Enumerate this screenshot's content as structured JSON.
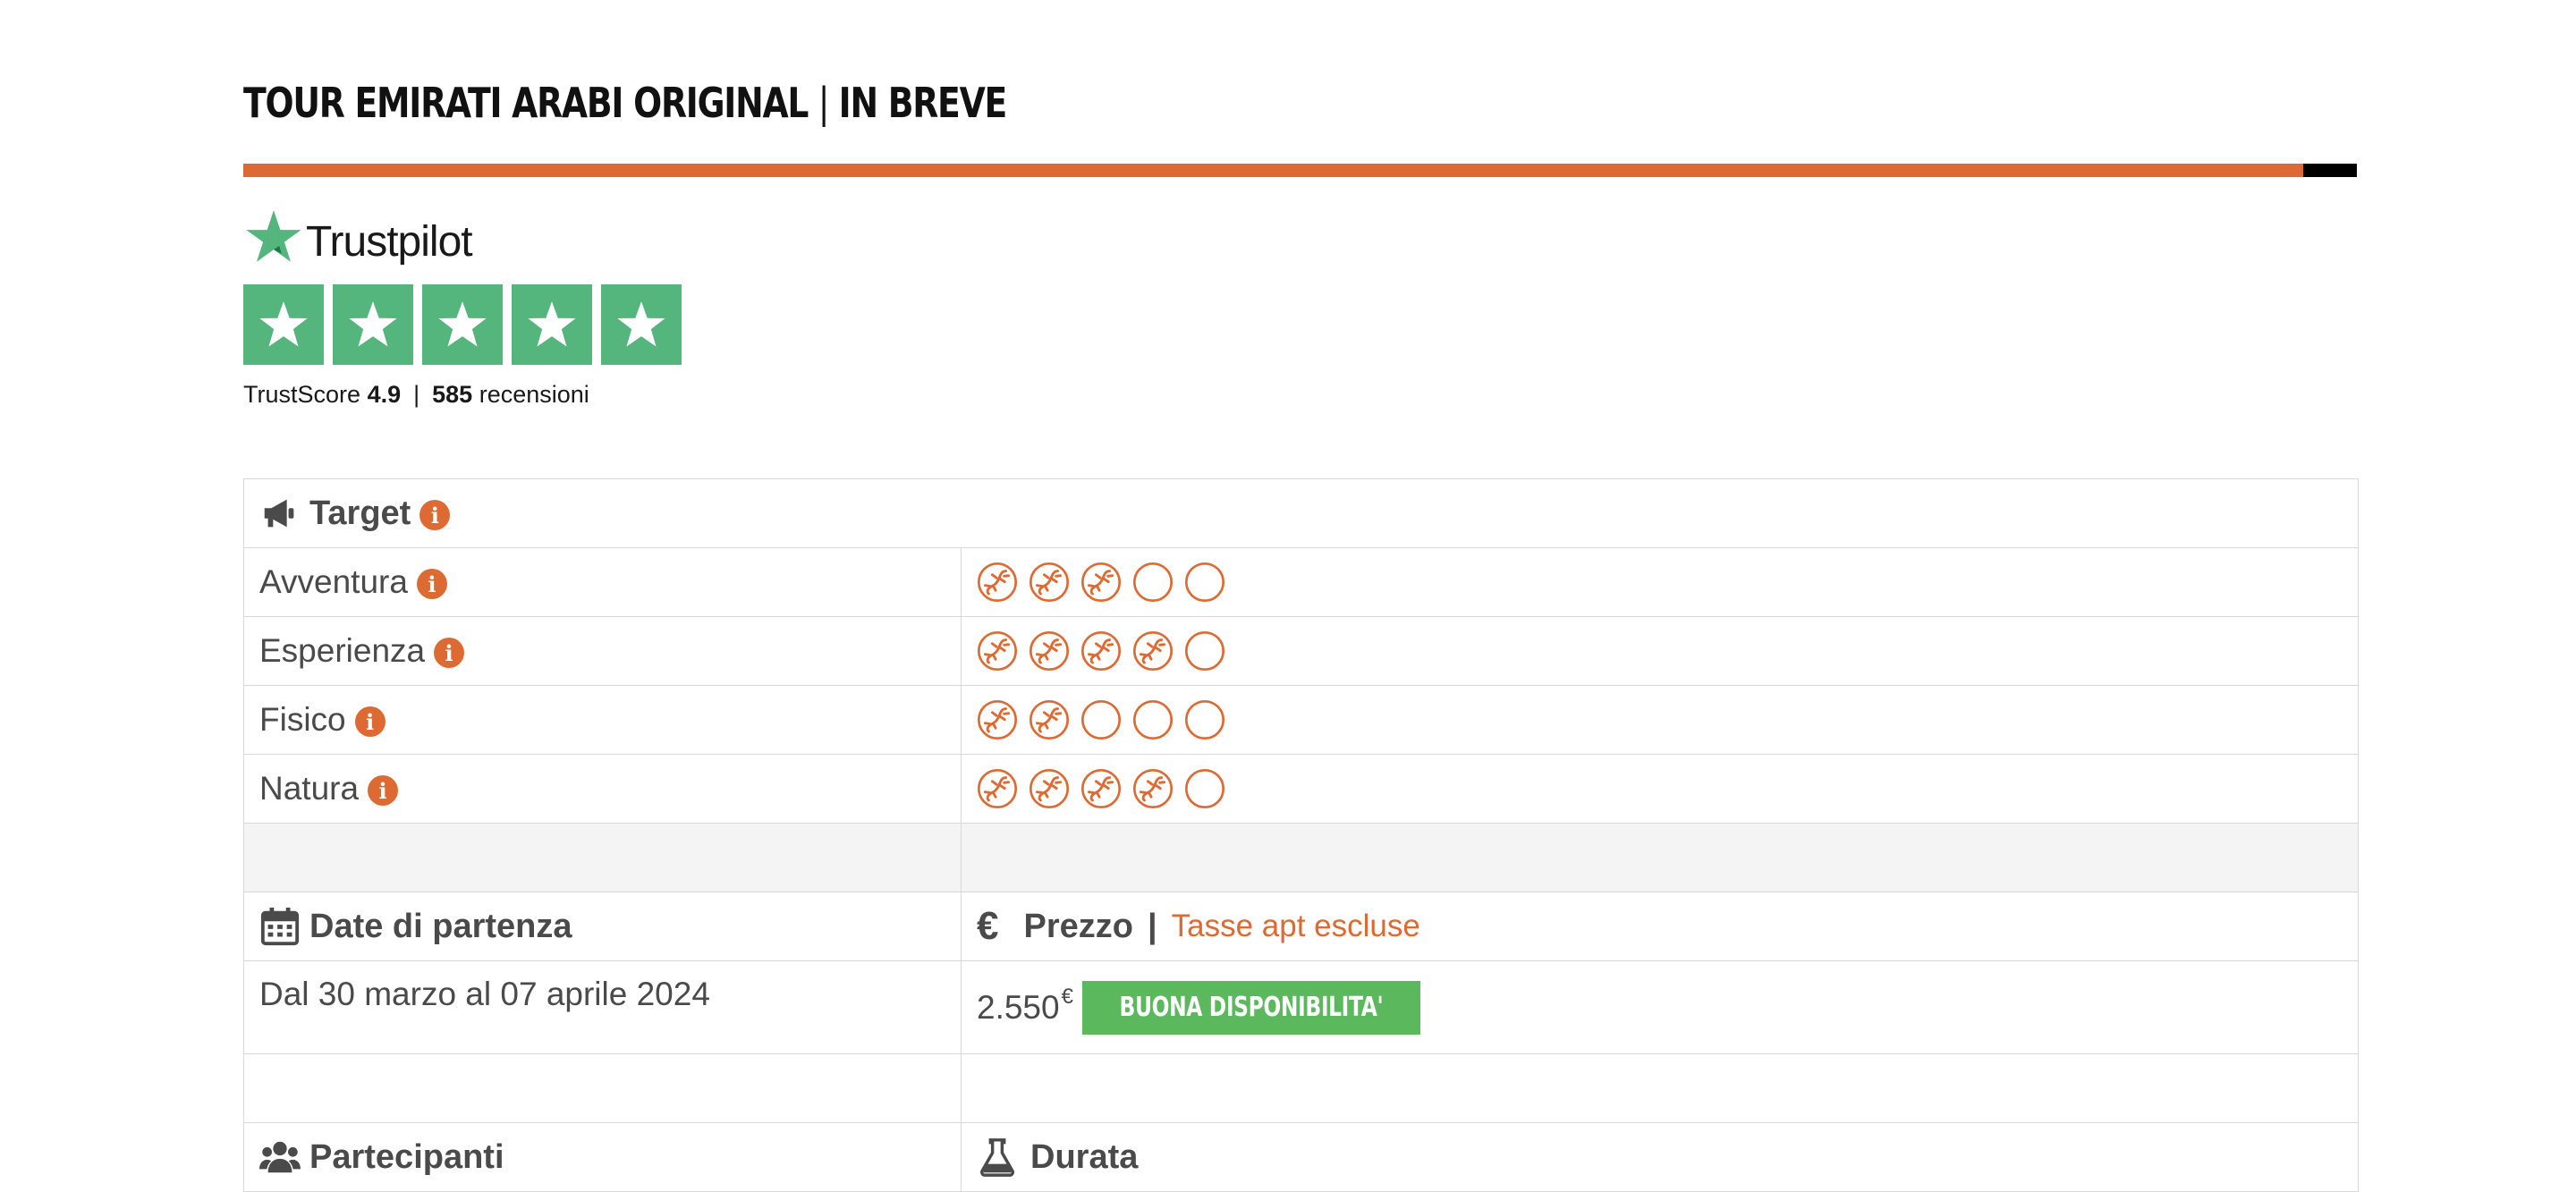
{
  "page": {
    "title_main": "TOUR EMIRATI ARABI ORIGINAL",
    "title_sep": "|",
    "title_sub": "IN BREVE"
  },
  "trustpilot": {
    "brand": "Trustpilot",
    "score_label": "TrustScore",
    "score": "4.9",
    "reviews_count": "585",
    "reviews_label": "recensioni",
    "stars": 5,
    "color": "#54b57d"
  },
  "colors": {
    "accent": "#de6a33",
    "badge": "#5cb85c"
  },
  "target": {
    "header": "Target",
    "rows": [
      {
        "label": "Avventura",
        "rating": 3,
        "max": 5
      },
      {
        "label": "Esperienza",
        "rating": 4,
        "max": 5
      },
      {
        "label": "Fisico",
        "rating": 2,
        "max": 5
      },
      {
        "label": "Natura",
        "rating": 4,
        "max": 5
      }
    ]
  },
  "departures": {
    "header": "Date di partenza",
    "value": "Dal 30 marzo al 07 aprile 2024"
  },
  "price": {
    "icon": "€",
    "header": "Prezzo",
    "sep": "|",
    "note": "Tasse apt escluse",
    "amount": "2.550",
    "currency": "€",
    "availability": "BUONA DISPONIBILITA'"
  },
  "participants": {
    "header": "Partecipanti"
  },
  "duration": {
    "header": "Durata"
  }
}
